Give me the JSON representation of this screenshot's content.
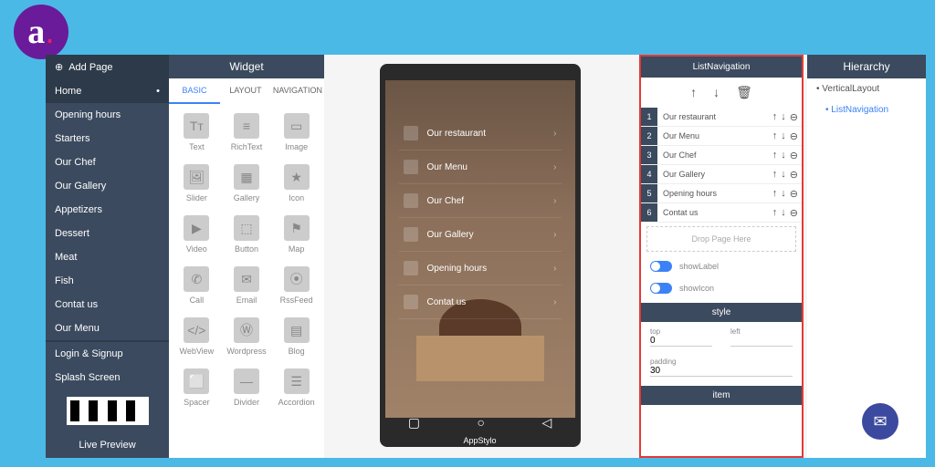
{
  "logo": {
    "letter": "a",
    "dot": "."
  },
  "sidebar": {
    "addPage": "Add Page",
    "pages": [
      "Home",
      "Opening hours",
      "Starters",
      "Our Chef",
      "Our Gallery",
      "Appetizers",
      "Dessert",
      "Meat",
      "Fish",
      "Contat us",
      "Our Menu"
    ],
    "loginSignup": "Login & Signup",
    "splash": "Splash Screen",
    "livePreview": "Live Preview"
  },
  "widget": {
    "title": "Widget",
    "tabs": [
      "BASIC",
      "LAYOUT",
      "NAVIGATION"
    ],
    "items": [
      "Text",
      "RichText",
      "Image",
      "Slider",
      "Gallery",
      "Icon",
      "Video",
      "Button",
      "Map",
      "Call",
      "Email",
      "RssFeed",
      "WebView",
      "Wordpress",
      "Blog",
      "Spacer",
      "Divider",
      "Accordion"
    ]
  },
  "phone": {
    "appName": "AppStylo",
    "items": [
      "Our restaurant",
      "Our Menu",
      "Our Chef",
      "Our Gallery",
      "Opening hours",
      "Contat us"
    ]
  },
  "props": {
    "title": "ListNavigation",
    "rows": [
      "Our restaurant",
      "Our Menu",
      "Our Chef",
      "Our Gallery",
      "Opening hours",
      "Contat us"
    ],
    "dropHere": "Drop Page Here",
    "showLabel": "showLabel",
    "showIcon": "showIcon",
    "styleHead": "style",
    "topLabel": "top",
    "topVal": "0",
    "leftLabel": "left",
    "paddingLabel": "padding",
    "paddingVal": "30",
    "itemHead": "item"
  },
  "hierarchy": {
    "title": "Hierarchy",
    "root": "VerticalLayout",
    "child": "ListNavigation"
  }
}
